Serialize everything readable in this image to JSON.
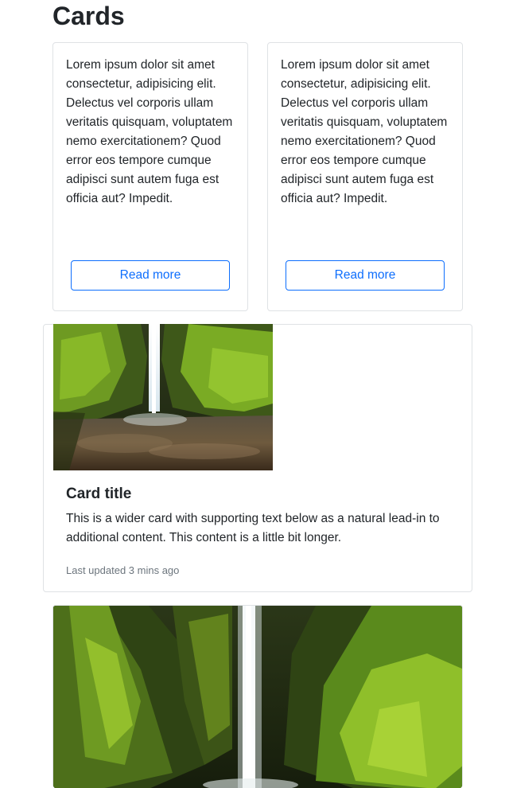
{
  "page": {
    "title": "Cards"
  },
  "text_cards": [
    {
      "text": "Lorem ipsum dolor sit amet consectetur, adipisicing elit. Delectus vel corporis ullam veritatis quisquam, voluptatem nemo exercitationem? Quod error eos tempore cumque adipisci sunt autem fuga est officia aut? Impedit.",
      "button_label": "Read more"
    },
    {
      "text": "Lorem ipsum dolor sit amet consectetur, adipisicing elit. Delectus vel corporis ullam veritatis quisquam, voluptatem nemo exercitationem? Quod error eos tempore cumque adipisci sunt autem fuga est officia aut? Impedit.",
      "button_label": "Read more"
    }
  ],
  "wide_card": {
    "image": "waterfall-canyon-photo",
    "title": "Card title",
    "text": "This is a wider card with supporting text below as a natural lead-in to additional content. This content is a little bit longer.",
    "muted": "Last updated 3 mins ago"
  },
  "image_card": {
    "image": "waterfall-canyon-photo"
  },
  "colors": {
    "primary": "#0d6efd",
    "border": "#dfe2e5",
    "muted": "#6c757d",
    "text": "#212529"
  }
}
